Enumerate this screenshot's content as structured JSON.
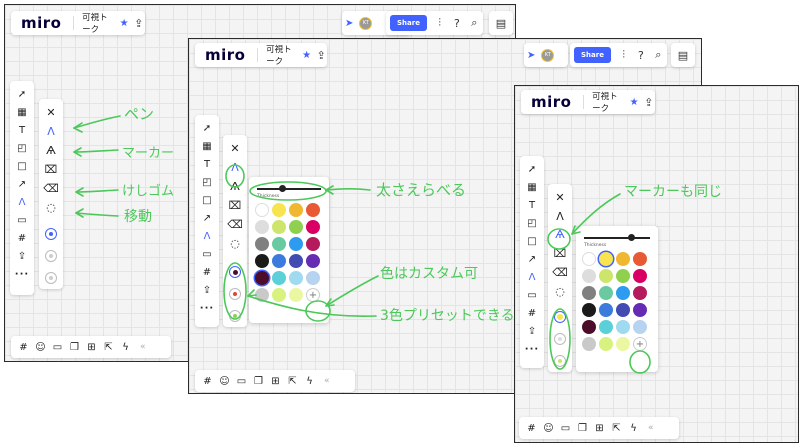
{
  "app": {
    "logo": "miro",
    "board_title": "可視トーク",
    "share_label": "Share",
    "avatar_initials": "KT",
    "collapse_glyph": "«"
  },
  "toolbar": {
    "icons": [
      "cursor-icon",
      "frame-template-icon",
      "text-icon",
      "sticky-note-icon",
      "shape-icon",
      "arrow-connector-icon",
      "pen-icon",
      "comment-icon",
      "frame-icon",
      "upload-icon",
      "more-icon"
    ]
  },
  "pen_panel": {
    "tools": [
      "close-icon",
      "pen-icon",
      "marker-icon",
      "highlighter-eraser-icon",
      "eraser-icon",
      "lasso-icon"
    ]
  },
  "color_panel": {
    "thickness_label": "Thickness",
    "thickness_level": 0.35,
    "colors": [
      "#ffffff",
      "#f7e44f",
      "#f0b830",
      "#e75a33",
      "#dddddd",
      "#cde56a",
      "#8fd14f",
      "#da0063",
      "#808080",
      "#69c9a0",
      "#2d9bf0",
      "#b51b5c",
      "#1a1a1a",
      "#3a7bdd",
      "#414bb2",
      "#652cb3",
      "#4b0d29",
      "#5bd0d8",
      "#9fdaf0",
      "#b6d3ef",
      "#c9c9c9",
      "#d7f27e",
      "#ecf7a2",
      "plus"
    ],
    "colors_marker": [
      "#ffffff",
      "#f7e44f",
      "#f0b830",
      "#e75a33",
      "#dddddd",
      "#cde56a",
      "#8fd14f",
      "#da0063",
      "#808080",
      "#69c9a0",
      "#2d9bf0",
      "#b51b5c",
      "#1a1a1a",
      "#3a7bdd",
      "#414bb2",
      "#652cb3",
      "#4b0d29",
      "#5bd0d8",
      "#9fdaf0",
      "#b6d3ef",
      "#c9c9c9",
      "#d7f27e",
      "#ecf7a2",
      "plus"
    ]
  },
  "presets_shot1": [
    "#4262ff",
    "#cccccc",
    "#cccccc"
  ],
  "presets_shot2": [
    "#4b0d29",
    "#e7432f",
    "#8fd14f"
  ],
  "presets_shot3": [
    "#f7e44f",
    "#dddddd",
    "#cde56a"
  ],
  "annotations": {
    "pen": "ペン",
    "marker": "マーカー",
    "eraser": "けしゴム",
    "move": "移動",
    "thickness": "太さえらべる",
    "custom_color": "色はカスタム可",
    "presets": "3色プリセットできる",
    "marker_same": "マーカーも同じ"
  },
  "colors": {
    "accent": "#4262ff",
    "annotation_green": "#4cc85a"
  }
}
